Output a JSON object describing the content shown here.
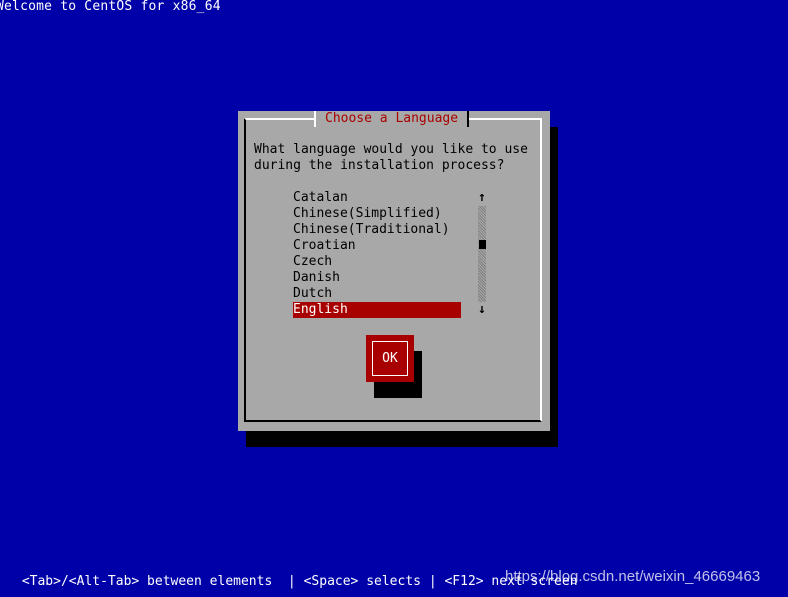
{
  "header": {
    "welcome_text": "Welcome to CentOS for x86_64"
  },
  "dialog": {
    "title": "Choose a Language",
    "prompt": "What language would you like to use\nduring the installation process?",
    "languages": [
      "Catalan",
      "Chinese(Simplified)",
      "Chinese(Traditional)",
      "Croatian",
      "Czech",
      "Danish",
      "Dutch",
      "English"
    ],
    "selected_language": "English",
    "ok_label": "OK"
  },
  "scrollbar": {
    "up_arrow": "↑",
    "down_arrow": "↓"
  },
  "footer": {
    "help_text": " <Tab>/<Alt-Tab> between elements  | <Space> selects | <F12> next screen"
  },
  "watermark": {
    "text": "https://blog.csdn.net/weixin_46669463"
  },
  "colors": {
    "background": "#0000a8",
    "dialog_bg": "#a8a8a8",
    "accent_red": "#a80000",
    "shadow": "#000000"
  }
}
